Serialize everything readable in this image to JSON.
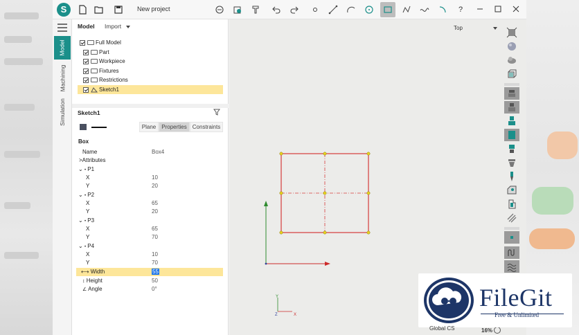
{
  "window": {
    "project_title": "New project"
  },
  "vertical_tabs": [
    {
      "label": "Model",
      "active": true
    },
    {
      "label": "Machining",
      "active": false
    },
    {
      "label": "Simulation",
      "active": false
    }
  ],
  "model_panel": {
    "title": "Model",
    "import_label": "Import",
    "tree": [
      {
        "label": "Full Model",
        "type": "folder",
        "checked": true
      },
      {
        "label": "Part",
        "type": "folder",
        "checked": true
      },
      {
        "label": "Workpiece",
        "type": "folder",
        "checked": true
      },
      {
        "label": "Fixtures",
        "type": "folder",
        "checked": true
      },
      {
        "label": "Restrictions",
        "type": "folder",
        "checked": true
      },
      {
        "label": "Sketch1",
        "type": "sketch",
        "checked": true,
        "selected": true
      }
    ]
  },
  "sketch_panel": {
    "title": "Sketch1",
    "tabs": [
      "Plane",
      "Properties",
      "Constraints"
    ],
    "active_tab": "Properties",
    "line_color": "#4a5060",
    "section": "Box",
    "name_label": "Name",
    "name_value": "Box4",
    "attributes_label": ">Attributes",
    "points": [
      {
        "label": "P1",
        "x_label": "X",
        "x": "10",
        "y_label": "Y",
        "y": "20"
      },
      {
        "label": "P2",
        "x_label": "X",
        "x": "65",
        "y_label": "Y",
        "y": "20"
      },
      {
        "label": "P3",
        "x_label": "X",
        "x": "65",
        "y_label": "Y",
        "y": "70"
      },
      {
        "label": "P4",
        "x_label": "X",
        "x": "10",
        "y_label": "Y",
        "y": "70"
      }
    ],
    "width_label": "Width",
    "width_value": "55",
    "height_label": "Height",
    "height_value": "50",
    "angle_label": "Angle",
    "angle_value": "0°"
  },
  "viewport": {
    "view_name": "Top",
    "triad_labels": {
      "y": "Y",
      "z": "Z",
      "x": "X"
    },
    "status_cs": "Global CS",
    "zoom": "16%",
    "sketch_color": "#d63b3b",
    "vertex_color": "#e8d21f"
  },
  "watermark": {
    "name": "FileGit",
    "tagline": "Free & Unlimited"
  },
  "colors": {
    "accent": "#1b8f8a",
    "selection": "#fde69a"
  }
}
